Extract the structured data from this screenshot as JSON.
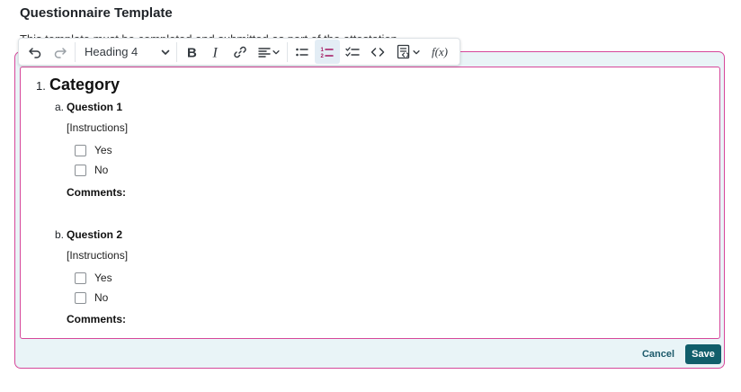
{
  "page": {
    "title": "Questionnaire Template",
    "description": "This template must be completed and submitted as part of the attestation"
  },
  "toolbar": {
    "heading_select_value": "Heading 4",
    "function_label": "f(x)",
    "icons": [
      "undo-icon",
      "redo-icon",
      "chevron-down-icon",
      "bold-icon",
      "italic-icon",
      "link-icon",
      "align-icon",
      "bulleted-list-icon",
      "numbered-list-icon",
      "checklist-icon",
      "code-icon",
      "insert-template-icon",
      "function-icon"
    ]
  },
  "document": {
    "category": {
      "number": "1.",
      "title": "Category"
    },
    "questions": [
      {
        "number": "a.",
        "title": "Question 1",
        "instructions": "[Instructions]",
        "options": [
          "Yes",
          "No"
        ],
        "comments_label": "Comments:"
      },
      {
        "number": "b.",
        "title": "Question 2",
        "instructions": "[Instructions]",
        "options": [
          "Yes",
          "No"
        ],
        "comments_label": "Comments:"
      }
    ]
  },
  "actions": {
    "cancel": "Cancel",
    "save": "Save"
  },
  "colors": {
    "accent_border": "#d6479a",
    "primary": "#115e6b",
    "frame_background": "#e9f4f7"
  }
}
